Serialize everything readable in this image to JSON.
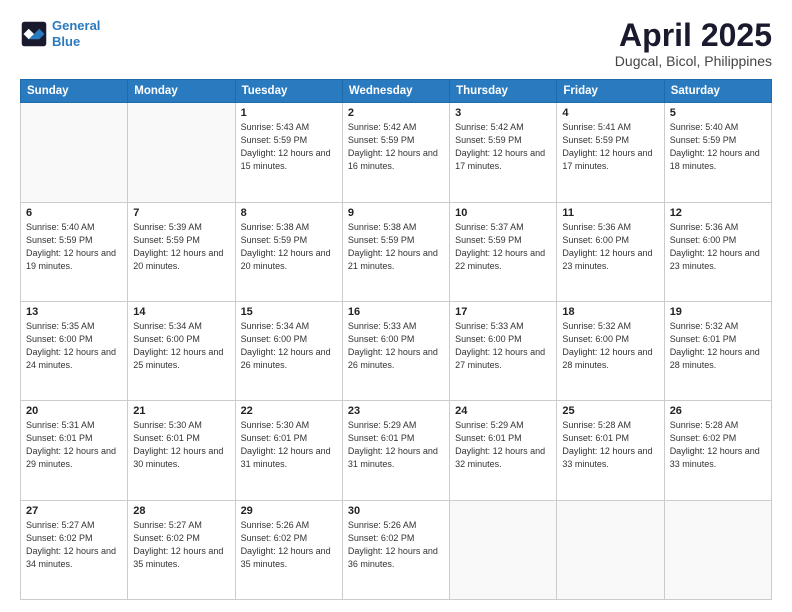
{
  "logo": {
    "line1": "General",
    "line2": "Blue"
  },
  "title": "April 2025",
  "subtitle": "Dugcal, Bicol, Philippines",
  "header_days": [
    "Sunday",
    "Monday",
    "Tuesday",
    "Wednesday",
    "Thursday",
    "Friday",
    "Saturday"
  ],
  "weeks": [
    [
      {
        "day": "",
        "info": ""
      },
      {
        "day": "",
        "info": ""
      },
      {
        "day": "1",
        "info": "Sunrise: 5:43 AM\nSunset: 5:59 PM\nDaylight: 12 hours and 15 minutes."
      },
      {
        "day": "2",
        "info": "Sunrise: 5:42 AM\nSunset: 5:59 PM\nDaylight: 12 hours and 16 minutes."
      },
      {
        "day": "3",
        "info": "Sunrise: 5:42 AM\nSunset: 5:59 PM\nDaylight: 12 hours and 17 minutes."
      },
      {
        "day": "4",
        "info": "Sunrise: 5:41 AM\nSunset: 5:59 PM\nDaylight: 12 hours and 17 minutes."
      },
      {
        "day": "5",
        "info": "Sunrise: 5:40 AM\nSunset: 5:59 PM\nDaylight: 12 hours and 18 minutes."
      }
    ],
    [
      {
        "day": "6",
        "info": "Sunrise: 5:40 AM\nSunset: 5:59 PM\nDaylight: 12 hours and 19 minutes."
      },
      {
        "day": "7",
        "info": "Sunrise: 5:39 AM\nSunset: 5:59 PM\nDaylight: 12 hours and 20 minutes."
      },
      {
        "day": "8",
        "info": "Sunrise: 5:38 AM\nSunset: 5:59 PM\nDaylight: 12 hours and 20 minutes."
      },
      {
        "day": "9",
        "info": "Sunrise: 5:38 AM\nSunset: 5:59 PM\nDaylight: 12 hours and 21 minutes."
      },
      {
        "day": "10",
        "info": "Sunrise: 5:37 AM\nSunset: 5:59 PM\nDaylight: 12 hours and 22 minutes."
      },
      {
        "day": "11",
        "info": "Sunrise: 5:36 AM\nSunset: 6:00 PM\nDaylight: 12 hours and 23 minutes."
      },
      {
        "day": "12",
        "info": "Sunrise: 5:36 AM\nSunset: 6:00 PM\nDaylight: 12 hours and 23 minutes."
      }
    ],
    [
      {
        "day": "13",
        "info": "Sunrise: 5:35 AM\nSunset: 6:00 PM\nDaylight: 12 hours and 24 minutes."
      },
      {
        "day": "14",
        "info": "Sunrise: 5:34 AM\nSunset: 6:00 PM\nDaylight: 12 hours and 25 minutes."
      },
      {
        "day": "15",
        "info": "Sunrise: 5:34 AM\nSunset: 6:00 PM\nDaylight: 12 hours and 26 minutes."
      },
      {
        "day": "16",
        "info": "Sunrise: 5:33 AM\nSunset: 6:00 PM\nDaylight: 12 hours and 26 minutes."
      },
      {
        "day": "17",
        "info": "Sunrise: 5:33 AM\nSunset: 6:00 PM\nDaylight: 12 hours and 27 minutes."
      },
      {
        "day": "18",
        "info": "Sunrise: 5:32 AM\nSunset: 6:00 PM\nDaylight: 12 hours and 28 minutes."
      },
      {
        "day": "19",
        "info": "Sunrise: 5:32 AM\nSunset: 6:01 PM\nDaylight: 12 hours and 28 minutes."
      }
    ],
    [
      {
        "day": "20",
        "info": "Sunrise: 5:31 AM\nSunset: 6:01 PM\nDaylight: 12 hours and 29 minutes."
      },
      {
        "day": "21",
        "info": "Sunrise: 5:30 AM\nSunset: 6:01 PM\nDaylight: 12 hours and 30 minutes."
      },
      {
        "day": "22",
        "info": "Sunrise: 5:30 AM\nSunset: 6:01 PM\nDaylight: 12 hours and 31 minutes."
      },
      {
        "day": "23",
        "info": "Sunrise: 5:29 AM\nSunset: 6:01 PM\nDaylight: 12 hours and 31 minutes."
      },
      {
        "day": "24",
        "info": "Sunrise: 5:29 AM\nSunset: 6:01 PM\nDaylight: 12 hours and 32 minutes."
      },
      {
        "day": "25",
        "info": "Sunrise: 5:28 AM\nSunset: 6:01 PM\nDaylight: 12 hours and 33 minutes."
      },
      {
        "day": "26",
        "info": "Sunrise: 5:28 AM\nSunset: 6:02 PM\nDaylight: 12 hours and 33 minutes."
      }
    ],
    [
      {
        "day": "27",
        "info": "Sunrise: 5:27 AM\nSunset: 6:02 PM\nDaylight: 12 hours and 34 minutes."
      },
      {
        "day": "28",
        "info": "Sunrise: 5:27 AM\nSunset: 6:02 PM\nDaylight: 12 hours and 35 minutes."
      },
      {
        "day": "29",
        "info": "Sunrise: 5:26 AM\nSunset: 6:02 PM\nDaylight: 12 hours and 35 minutes."
      },
      {
        "day": "30",
        "info": "Sunrise: 5:26 AM\nSunset: 6:02 PM\nDaylight: 12 hours and 36 minutes."
      },
      {
        "day": "",
        "info": ""
      },
      {
        "day": "",
        "info": ""
      },
      {
        "day": "",
        "info": ""
      }
    ]
  ]
}
